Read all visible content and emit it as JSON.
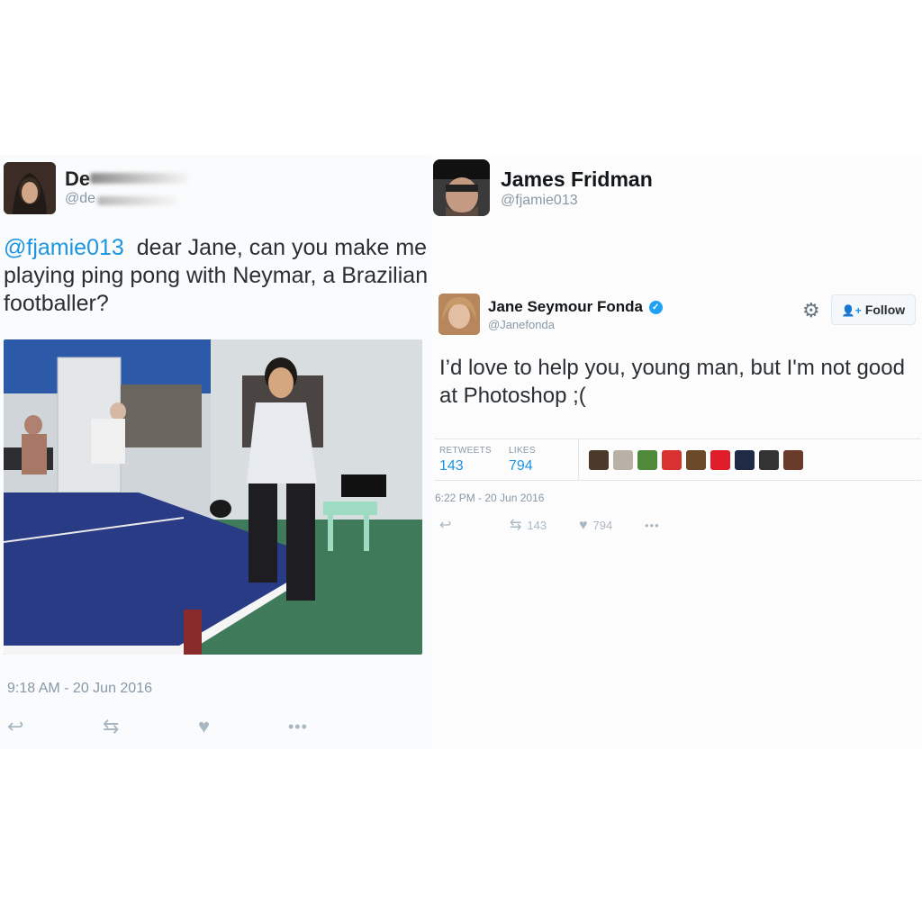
{
  "left_tweet": {
    "author_name": "De",
    "author_handle": "@de",
    "mention": "@fjamie013",
    "text": "dear Jane, can you make me playing ping pong with Neymar, a Brazilian footballer?",
    "timestamp": "9:18 AM - 20 Jun 2016",
    "actions": [
      "reply-icon",
      "retweet-icon",
      "heart-icon",
      "more-icon"
    ]
  },
  "right_tweet": {
    "author_name": "James Fridman",
    "author_handle": "@fjamie013",
    "embedded": {
      "author_name": "Jane Seymour Fonda",
      "verified": "✓",
      "author_handle": "@Janefonda",
      "follow_label": "Follow",
      "text": "I’d love to help you, young man, but I'm not good at Photoshop ;(",
      "retweets_label": "RETWEETS",
      "retweets_value": "143",
      "likes_label": "LIKES",
      "likes_value": "794",
      "liker_count": 10,
      "timestamp": "6:22 PM - 20 Jun 2016",
      "retweet_count": "143",
      "like_count": "794"
    }
  },
  "colors": {
    "link": "#1b95e0",
    "muted": "#8899a6",
    "text": "#292f33"
  }
}
